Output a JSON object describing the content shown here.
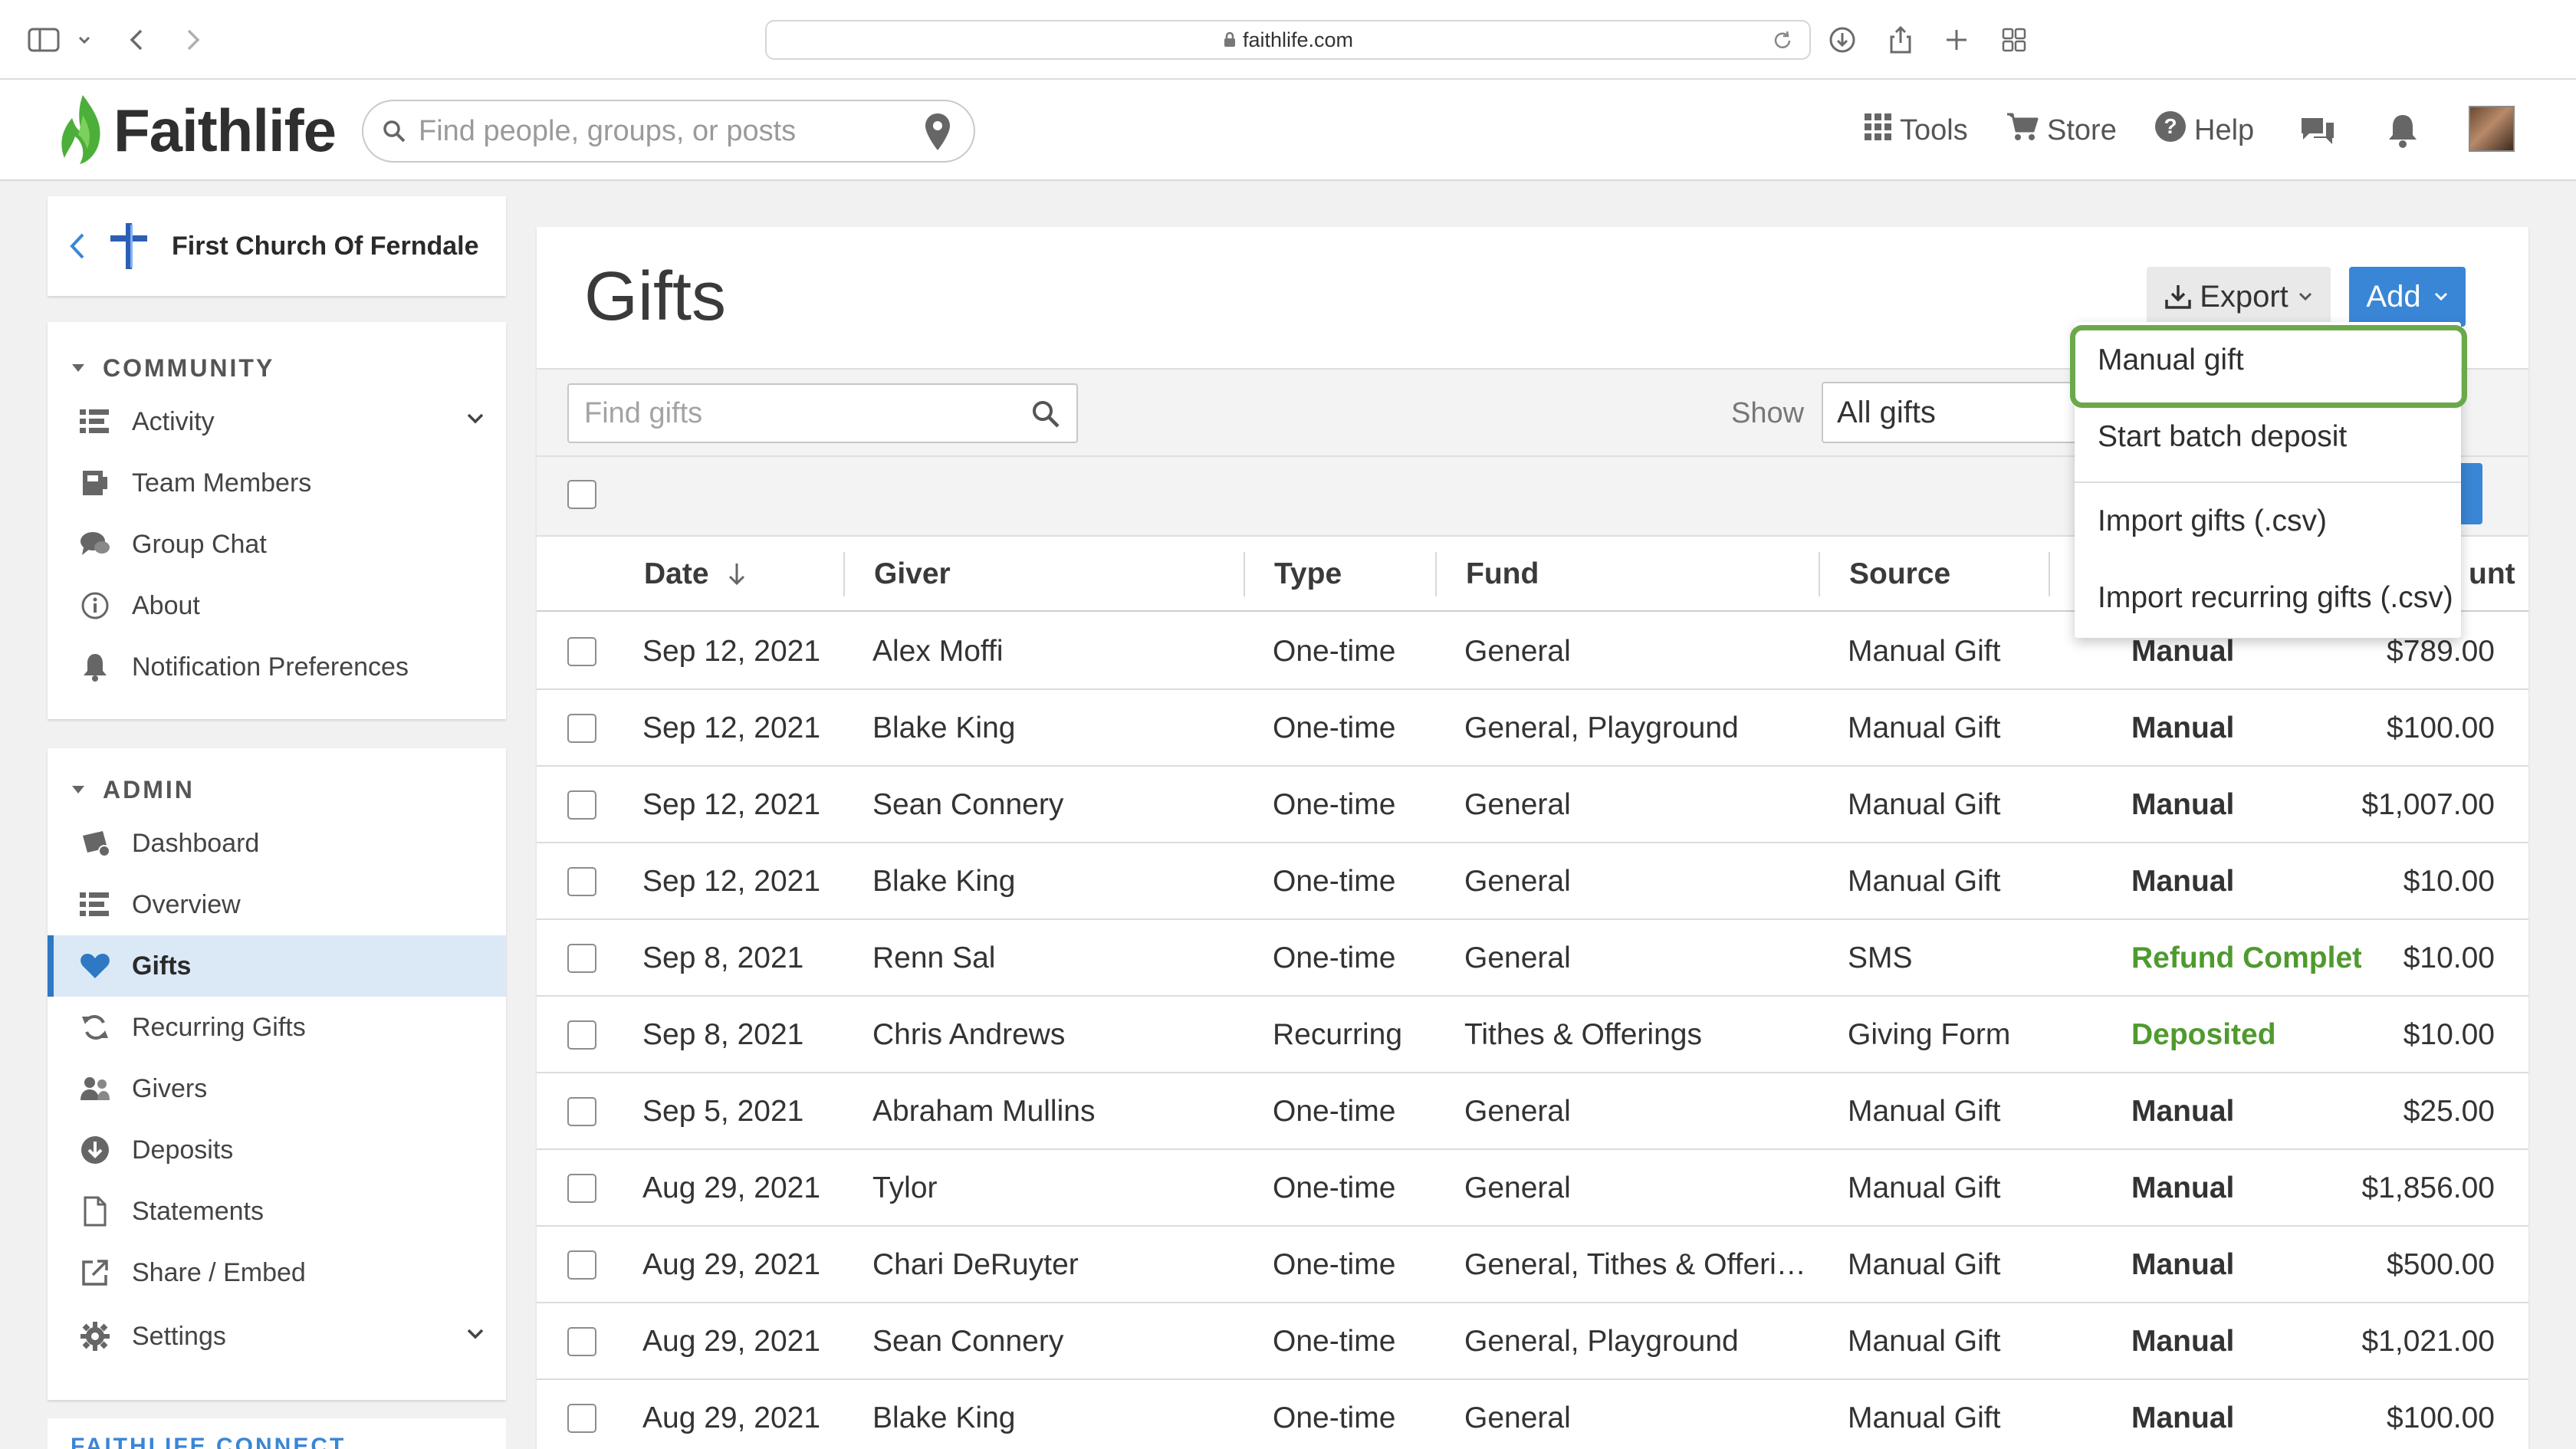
{
  "browser": {
    "url": "faithlife.com"
  },
  "header": {
    "brand": "Faithlife",
    "search_placeholder": "Find people, groups, or posts",
    "links": {
      "tools": "Tools",
      "store": "Store",
      "help": "Help"
    }
  },
  "sidebar": {
    "church_name": "First Church Of Ferndale",
    "community": {
      "title": "COMMUNITY",
      "items": [
        {
          "label": "Activity",
          "icon": "activity-icon"
        },
        {
          "label": "Team Members",
          "icon": "team-members-icon"
        },
        {
          "label": "Group Chat",
          "icon": "chat-icon"
        },
        {
          "label": "About",
          "icon": "info-icon"
        },
        {
          "label": "Notification Preferences",
          "icon": "bell-icon"
        }
      ]
    },
    "admin": {
      "title": "ADMIN",
      "items": [
        {
          "label": "Dashboard",
          "icon": "dashboard-icon"
        },
        {
          "label": "Overview",
          "icon": "overview-icon"
        },
        {
          "label": "Gifts",
          "icon": "heart-icon",
          "active": true
        },
        {
          "label": "Recurring Gifts",
          "icon": "recurring-icon"
        },
        {
          "label": "Givers",
          "icon": "givers-icon"
        },
        {
          "label": "Deposits",
          "icon": "deposits-icon"
        },
        {
          "label": "Statements",
          "icon": "statements-icon"
        },
        {
          "label": "Share / Embed",
          "icon": "share-icon"
        },
        {
          "label": "Settings",
          "icon": "gear-icon"
        }
      ]
    },
    "connect_title": "FAITHLIFE CONNECT"
  },
  "main": {
    "title": "Gifts",
    "export_label": "Export",
    "add_label": "Add",
    "find_placeholder": "Find gifts",
    "show_label": "Show",
    "show_value": "All gifts",
    "columns": {
      "date": "Date",
      "giver": "Giver",
      "type": "Type",
      "fund": "Fund",
      "source": "Source",
      "amount_partial": "unt"
    },
    "rows": [
      {
        "date": "Sep 12, 2021",
        "giver": "Alex Moffi",
        "type": "One-time",
        "fund": "General",
        "source": "Manual Gift",
        "status": "Manual",
        "status_kind": "manual",
        "amount": "$789.00"
      },
      {
        "date": "Sep 12, 2021",
        "giver": "Blake King",
        "type": "One-time",
        "fund": "General, Playground",
        "source": "Manual Gift",
        "status": "Manual",
        "status_kind": "manual",
        "amount": "$100.00"
      },
      {
        "date": "Sep 12, 2021",
        "giver": "Sean Connery",
        "type": "One-time",
        "fund": "General",
        "source": "Manual Gift",
        "status": "Manual",
        "status_kind": "manual",
        "amount": "$1,007.00"
      },
      {
        "date": "Sep 12, 2021",
        "giver": "Blake King",
        "type": "One-time",
        "fund": "General",
        "source": "Manual Gift",
        "status": "Manual",
        "status_kind": "manual",
        "amount": "$10.00"
      },
      {
        "date": "Sep 8, 2021",
        "giver": "Renn Sal",
        "type": "One-time",
        "fund": "General",
        "source": "SMS",
        "status": "Refund Complet",
        "status_kind": "refund",
        "amount": "$10.00"
      },
      {
        "date": "Sep 8, 2021",
        "giver": "Chris Andrews",
        "type": "Recurring",
        "fund": "Tithes & Offerings",
        "source": "Giving Form",
        "status": "Deposited",
        "status_kind": "deposited",
        "amount": "$10.00"
      },
      {
        "date": "Sep 5, 2021",
        "giver": "Abraham Mullins",
        "type": "One-time",
        "fund": "General",
        "source": "Manual Gift",
        "status": "Manual",
        "status_kind": "manual",
        "amount": "$25.00"
      },
      {
        "date": "Aug 29, 2021",
        "giver": "Tylor",
        "type": "One-time",
        "fund": "General",
        "source": "Manual Gift",
        "status": "Manual",
        "status_kind": "manual",
        "amount": "$1,856.00"
      },
      {
        "date": "Aug 29, 2021",
        "giver": "Chari DeRuyter",
        "type": "One-time",
        "fund": "General, Tithes & Offeri…",
        "source": "Manual Gift",
        "status": "Manual",
        "status_kind": "manual",
        "amount": "$500.00"
      },
      {
        "date": "Aug 29, 2021",
        "giver": "Sean Connery",
        "type": "One-time",
        "fund": "General, Playground",
        "source": "Manual Gift",
        "status": "Manual",
        "status_kind": "manual",
        "amount": "$1,021.00"
      },
      {
        "date": "Aug 29, 2021",
        "giver": "Blake King",
        "type": "One-time",
        "fund": "General",
        "source": "Manual Gift",
        "status": "Manual",
        "status_kind": "manual",
        "amount": "$100.00"
      }
    ]
  },
  "add_menu": {
    "items": [
      "Manual gift",
      "Start batch deposit",
      "Import gifts (.csv)",
      "Import recurring gifts (.csv)"
    ],
    "highlighted": "Manual gift"
  },
  "colors": {
    "accent_blue": "#3a86d6",
    "active_bg": "#dbe9f7",
    "status_green": "#4f9a2e",
    "highlight_green": "#6ba84a",
    "logo_green": "#4caf3a"
  }
}
